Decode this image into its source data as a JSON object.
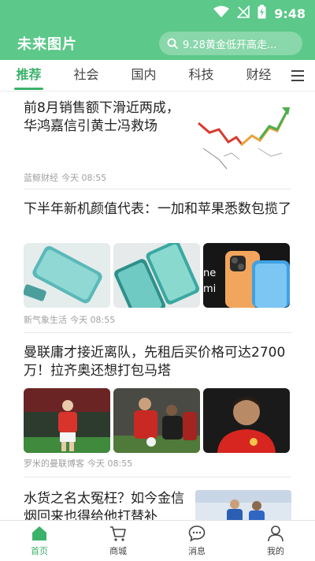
{
  "status": {
    "time": "9:48",
    "icons": [
      "wifi-icon",
      "signal-off-icon",
      "battery-charging-icon"
    ]
  },
  "app": {
    "logo": "未来图片"
  },
  "search": {
    "placeholder": "9.28黄金低开高走..."
  },
  "tabs": [
    {
      "label": "推荐",
      "active": true
    },
    {
      "label": "社会",
      "active": false
    },
    {
      "label": "国内",
      "active": false
    },
    {
      "label": "科技",
      "active": false
    },
    {
      "label": "财经",
      "active": false
    }
  ],
  "feed": [
    {
      "title": "前8月销售额下滑近两成，华鸿嘉信引黄士冯救场",
      "source": "蓝鲸财经",
      "time": "今天 08:55",
      "image": "stock-chart-thumbnail"
    },
    {
      "title": "下半年新机颜值代表：一加和苹果悉数包揽了",
      "source": "新气象生活",
      "time": "今天 08:55",
      "images": [
        "green-phone-front-photo",
        "green-phone-angle-photo",
        "iphone-orange-blue-photo"
      ],
      "image_text": "ne mi"
    },
    {
      "title": "曼联庸才接近离队，先租后买价格可达2700万！拉齐奥还想打包马塔",
      "source": "罗米的曼联博客",
      "time": "今天 08:55",
      "images": [
        "player-red-kit-photo",
        "players-discussion-photo",
        "player-portrait-photo"
      ]
    },
    {
      "title": "水货之名太冤枉？如今金信烟回来也得给他打替补",
      "image": "football-match-photo"
    }
  ],
  "bottom_nav": [
    {
      "label": "首页",
      "icon": "home-icon",
      "active": true
    },
    {
      "label": "商城",
      "icon": "cart-icon",
      "active": false
    },
    {
      "label": "消息",
      "icon": "message-icon",
      "active": false
    },
    {
      "label": "我的",
      "icon": "user-icon",
      "active": false
    }
  ],
  "colors": {
    "brand": "#5cc889",
    "tab_active": "#3bb26a",
    "meta": "#a0a0a0"
  }
}
